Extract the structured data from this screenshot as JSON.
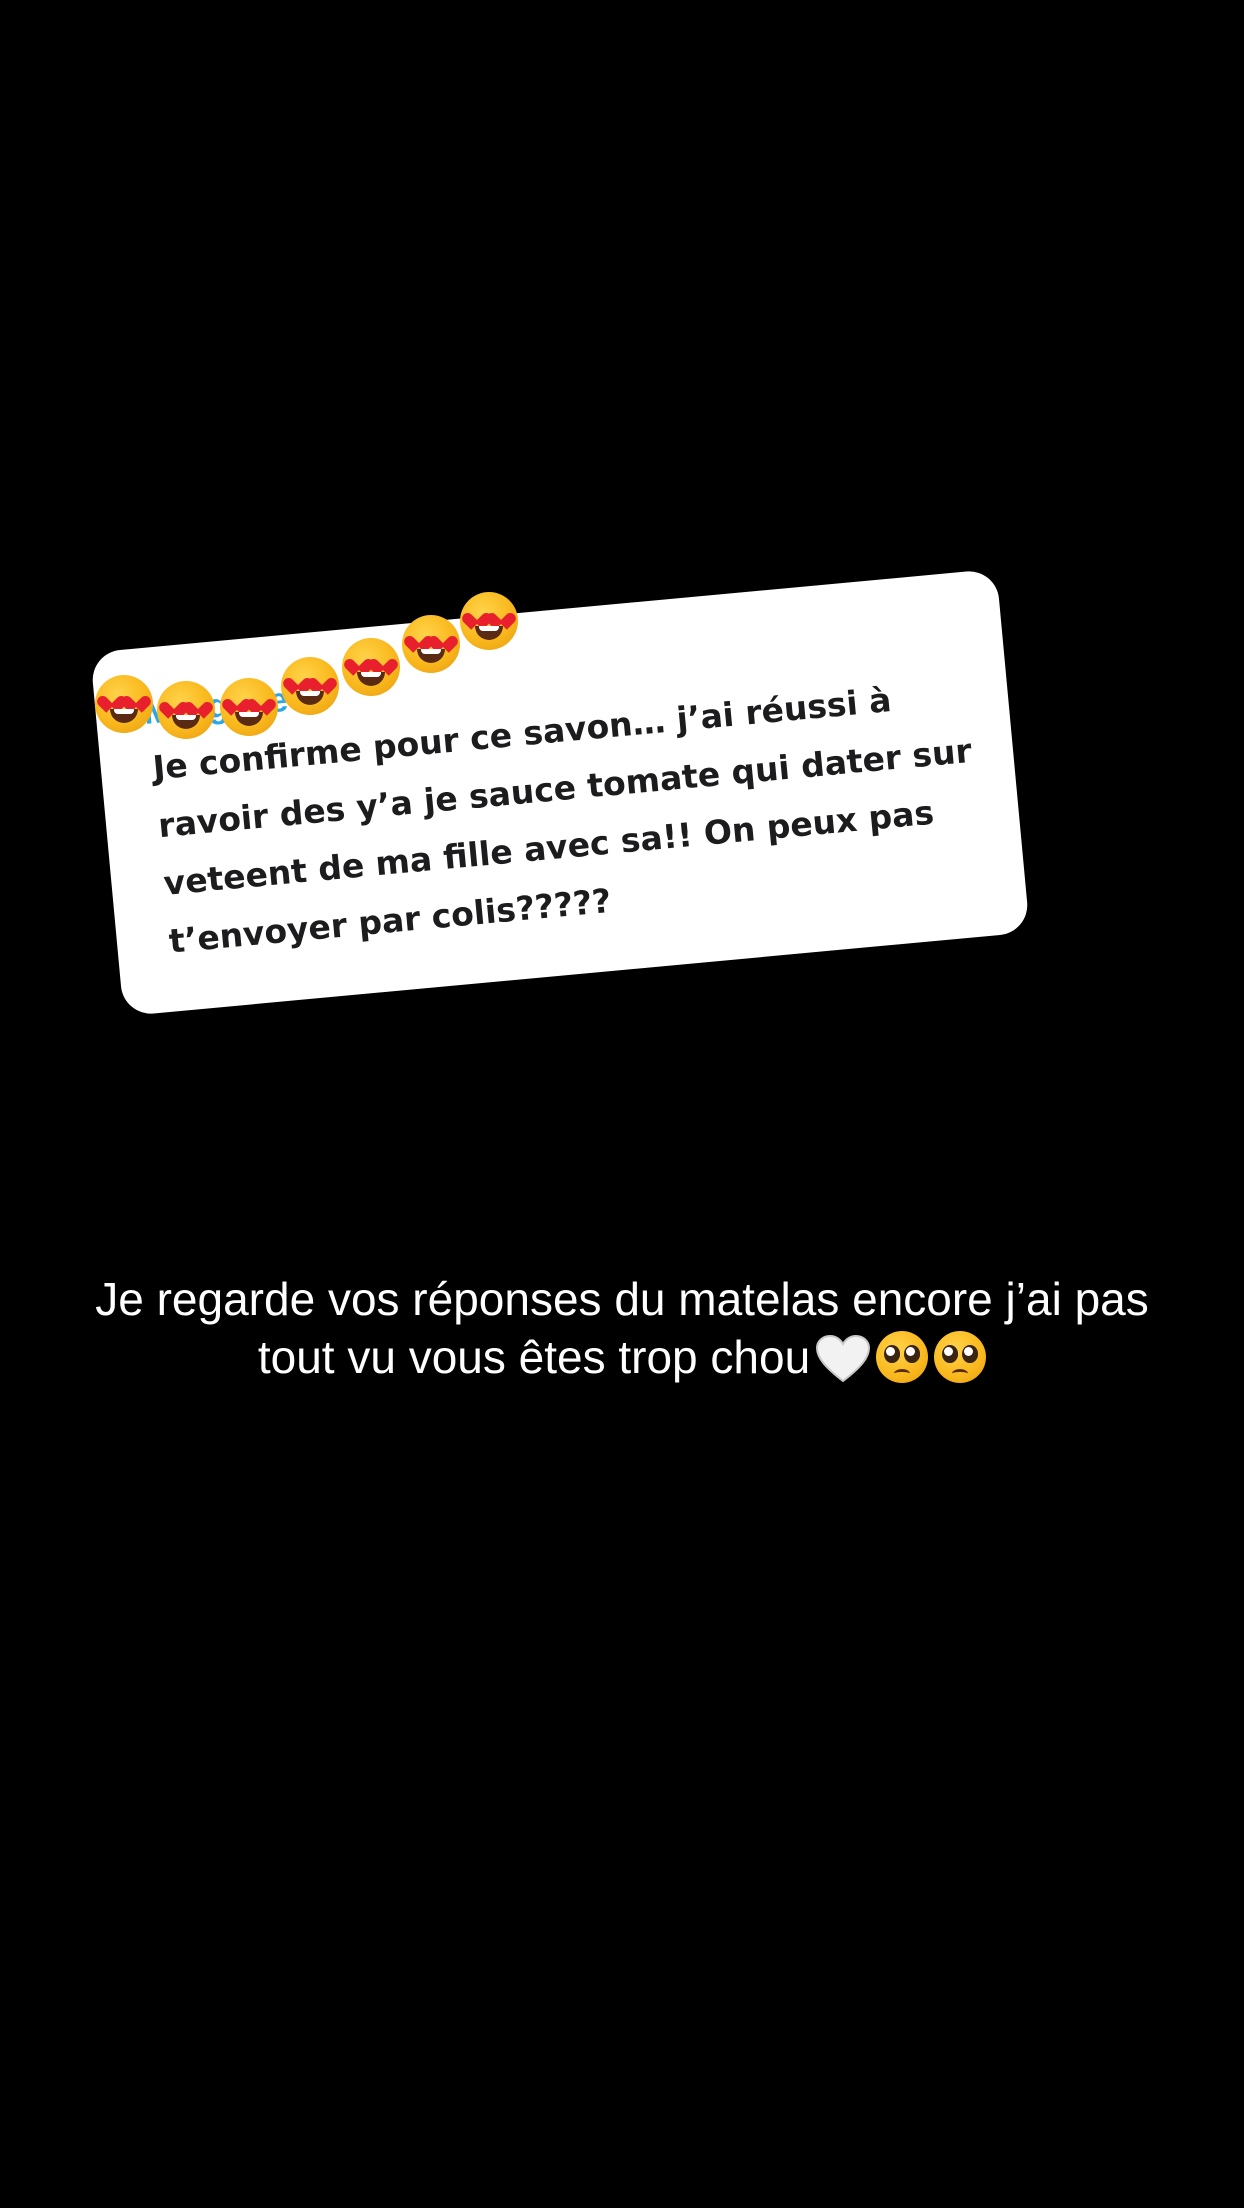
{
  "reply": {
    "name": "Morgane",
    "text": "Je confirme pour ce savon… j’ai réussi à\nravoir des y’a je sauce tomate qui dater sur\nveteent de ma fille avec sa!! On peux pas\nt’envoyer par colis?????"
  },
  "sticker": {
    "icon": "heart-eyes-emoji",
    "count": 7
  },
  "caption": {
    "text": "Je regarde vos réponses du matelas encore j’ai pas\ntout vu vous êtes trop chou",
    "emojis": [
      "white-heart-icon",
      "pleading-face-emoji",
      "pleading-face-emoji"
    ]
  },
  "colors": {
    "background": "#000000",
    "card": "#ffffff",
    "name": "#2aa7e6",
    "reply_text": "#1c1c1e",
    "caption_text": "#ffffff"
  }
}
